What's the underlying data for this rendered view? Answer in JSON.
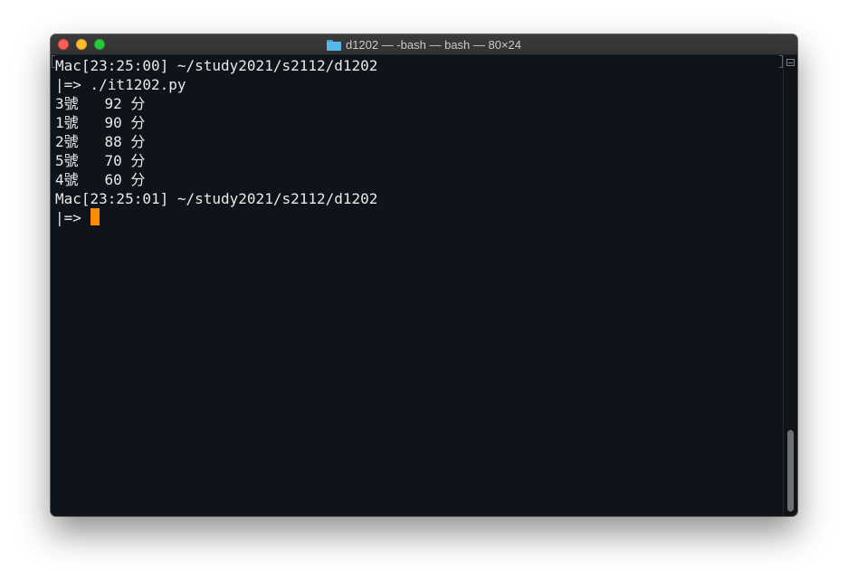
{
  "window": {
    "title": "d1202 — -bash — bash — 80×24",
    "title_icon": "folder-icon",
    "traffic_lights": {
      "close": "#fe5f57",
      "minimize": "#febc2e",
      "zoom": "#28c840"
    }
  },
  "terminal": {
    "background": "#0f131a",
    "foreground": "#eaeaea",
    "cursor_color": "#ff8c00",
    "lines": [
      "Mac[23:25:00] ~/study2021/s2112/d1202",
      "|=> ./it1202.py",
      "3號   92 分",
      "1號   90 分",
      "2號   88 分",
      "5號   70 分",
      "4號   60 分",
      "Mac[23:25:01] ~/study2021/s2112/d1202"
    ],
    "prompt": "|=> "
  }
}
